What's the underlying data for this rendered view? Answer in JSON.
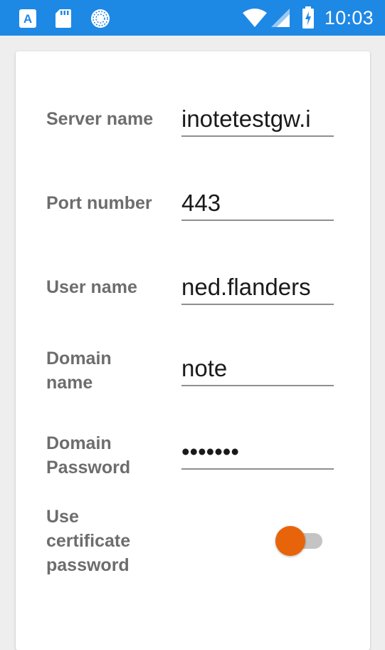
{
  "status_bar": {
    "time": "10:03",
    "icons": [
      "text-a-icon",
      "sd-card-icon",
      "sync-circle-icon",
      "wifi-icon",
      "cell-signal-icon",
      "battery-charging-icon"
    ],
    "background_color": "#1e88e5"
  },
  "form": {
    "fields": [
      {
        "label": "Server name",
        "value": "inotetestgw.i"
      },
      {
        "label": "Port number",
        "value": "443"
      },
      {
        "label": "User name",
        "value": "ned.flanders"
      },
      {
        "label": "Domain name",
        "value": "note"
      },
      {
        "label": "Domain Password",
        "value": "•••••••"
      }
    ],
    "certificate": {
      "label": "Use certificate password",
      "enabled": false,
      "thumb_color": "#e8640a"
    }
  }
}
